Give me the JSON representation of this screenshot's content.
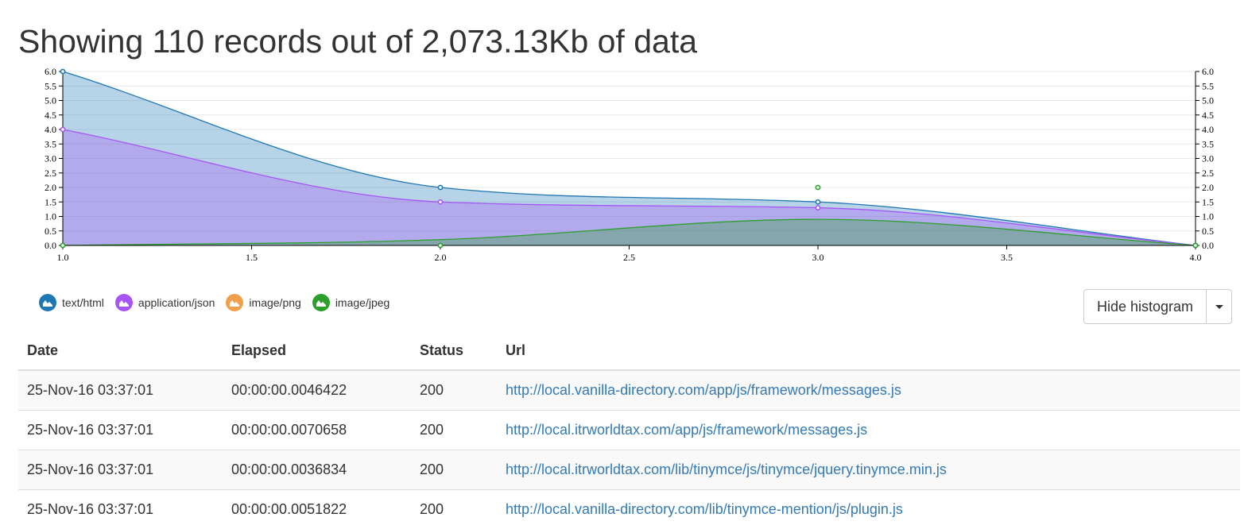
{
  "page": {
    "heading": "Showing 110 records out of 2,073.13Kb of data"
  },
  "chart_data": {
    "type": "area",
    "x": [
      1.0,
      2.0,
      3.0,
      4.0
    ],
    "series": [
      {
        "name": "text/html",
        "color": "#1f77b4",
        "values": [
          6,
          2,
          1.5,
          0
        ],
        "curve": true
      },
      {
        "name": "application/json",
        "color": "#a855f7",
        "values": [
          4,
          1.5,
          1.3,
          0
        ],
        "curve": true
      },
      {
        "name": "image/png",
        "color": "#f0a04b",
        "values": [],
        "curve": true
      },
      {
        "name": "image/jpeg",
        "color": "#2ca02c",
        "values": [
          0,
          0.2,
          0.9,
          0
        ],
        "curve": true,
        "points": [
          0,
          0,
          2,
          0
        ]
      }
    ],
    "xlim": [
      1.0,
      4.0
    ],
    "ylim": [
      0,
      6
    ],
    "x_ticks": [
      "1.0",
      "1.5",
      "2.0",
      "2.5",
      "3.0",
      "3.5",
      "4.0"
    ],
    "y_ticks": [
      "0.0",
      "0.5",
      "1.0",
      "1.5",
      "2.0",
      "2.5",
      "3.0",
      "3.5",
      "4.0",
      "4.5",
      "5.0",
      "5.5",
      "6.0"
    ],
    "grid": true,
    "y_axis_both_sides": true,
    "legend": "bottom-left"
  },
  "legend": {
    "items": [
      {
        "label": "text/html",
        "color": "#1f77b4",
        "icon": "area-chart-icon"
      },
      {
        "label": "application/json",
        "color": "#a855f7",
        "icon": "area-chart-icon"
      },
      {
        "label": "image/png",
        "color": "#f0a04b",
        "icon": "area-chart-icon"
      },
      {
        "label": "image/jpeg",
        "color": "#2ca02c",
        "icon": "area-chart-icon"
      }
    ]
  },
  "controls": {
    "hide_histogram_label": "Hide histogram",
    "dropdown_icon": "caret-down-icon"
  },
  "table": {
    "columns": [
      "Date",
      "Elapsed",
      "Status",
      "Url"
    ],
    "rows": [
      {
        "date": "25-Nov-16 03:37:01",
        "elapsed": "00:00:00.0046422",
        "status": "200",
        "url": "http://local.vanilla-directory.com/app/js/framework/messages.js"
      },
      {
        "date": "25-Nov-16 03:37:01",
        "elapsed": "00:00:00.0070658",
        "status": "200",
        "url": "http://local.itrworldtax.com/app/js/framework/messages.js"
      },
      {
        "date": "25-Nov-16 03:37:01",
        "elapsed": "00:00:00.0036834",
        "status": "200",
        "url": "http://local.itrworldtax.com/lib/tinymce/js/tinymce/jquery.tinymce.min.js"
      },
      {
        "date": "25-Nov-16 03:37:01",
        "elapsed": "00:00:00.0051822",
        "status": "200",
        "url": "http://local.vanilla-directory.com/lib/tinymce-mention/js/plugin.js"
      }
    ]
  }
}
